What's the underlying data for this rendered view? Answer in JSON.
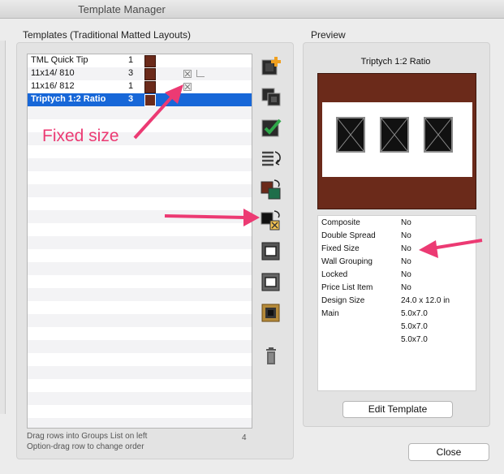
{
  "window": {
    "title": "Template Manager"
  },
  "templates": {
    "label": "Templates (Traditional Matted Layouts)",
    "rows": [
      {
        "name": "TML Quick Tip",
        "count": "1",
        "fixed_icon": false,
        "lock_icon": false,
        "selected": false
      },
      {
        "name": "11x14/ 810",
        "count": "3",
        "fixed_icon": true,
        "lock_icon": true,
        "selected": false
      },
      {
        "name": "11x16/ 812",
        "count": "1",
        "fixed_icon": true,
        "lock_icon": false,
        "selected": false
      },
      {
        "name": "Triptych 1:2 Ratio",
        "count": "3",
        "fixed_icon": false,
        "lock_icon": false,
        "selected": true
      }
    ],
    "hint_line1": "Drag rows into Groups List on left",
    "hint_line2": "Option-drag row to change order",
    "row_count": "4",
    "swatch_color": "#6b2a1a",
    "selection_color": "#1767d8"
  },
  "toolbar": {
    "icons": [
      "add-template-icon",
      "duplicate-template-icon",
      "edit-check-icon",
      "sort-list-icon",
      "swap-colors-icon",
      "swap-fixed-size-icon",
      "single-opening-icon",
      "single-opening-alt-icon",
      "ornate-frame-icon",
      "trash-icon"
    ]
  },
  "preview": {
    "label": "Preview",
    "title": "Triptych 1:2 Ratio",
    "properties": [
      {
        "label": "Composite",
        "value": "No"
      },
      {
        "label": "Double Spread",
        "value": "No"
      },
      {
        "label": "Fixed Size",
        "value": "No"
      },
      {
        "label": "Wall Grouping",
        "value": "No"
      },
      {
        "label": "Locked",
        "value": "No"
      },
      {
        "label": "Price List Item",
        "value": "No"
      },
      {
        "label": "Design Size",
        "value": "24.0 x 12.0 in"
      },
      {
        "label": "Main",
        "value": "5.0x7.0"
      },
      {
        "label": "",
        "value": "5.0x7.0"
      },
      {
        "label": "",
        "value": "5.0x7.0"
      }
    ],
    "edit_button": "Edit Template",
    "frame_color": "#6b2a1a"
  },
  "close_button": "Close",
  "annotation": {
    "text": "Fixed size",
    "color": "#ec3a73"
  }
}
